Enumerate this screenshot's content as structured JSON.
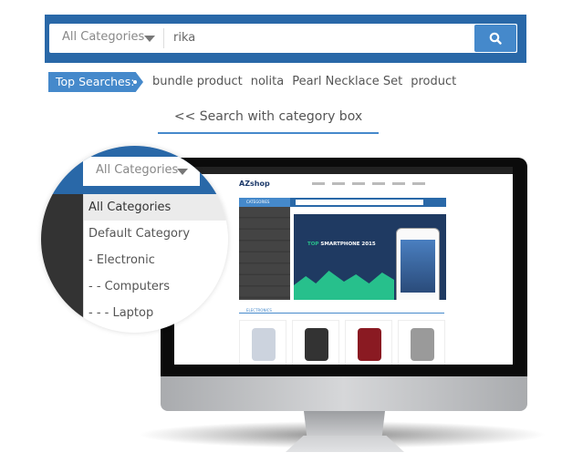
{
  "search": {
    "category": "All Categories",
    "query": "rika",
    "button_icon": "search-icon"
  },
  "top_searches": {
    "label": "Top Searches:",
    "tags": [
      "bundle product",
      "nolita",
      "Pearl Necklace Set",
      "product"
    ]
  },
  "caption": "<< Search with category box",
  "dropdown": {
    "selected": "All Categories",
    "options": [
      "All Categories",
      "Default Category",
      "- Electronic",
      "- - Computers",
      "- - - Laptop"
    ]
  },
  "screen_site": {
    "logo": "AZshop",
    "categories_label": "CATEGORIES",
    "banner_title_accent": "TOP",
    "banner_title": "SMARTPHONE 2015",
    "section": "ELECTRONICS"
  },
  "colors": {
    "brand_blue": "#2968a8",
    "accent_blue": "#4589cb",
    "green": "#27c08c"
  }
}
